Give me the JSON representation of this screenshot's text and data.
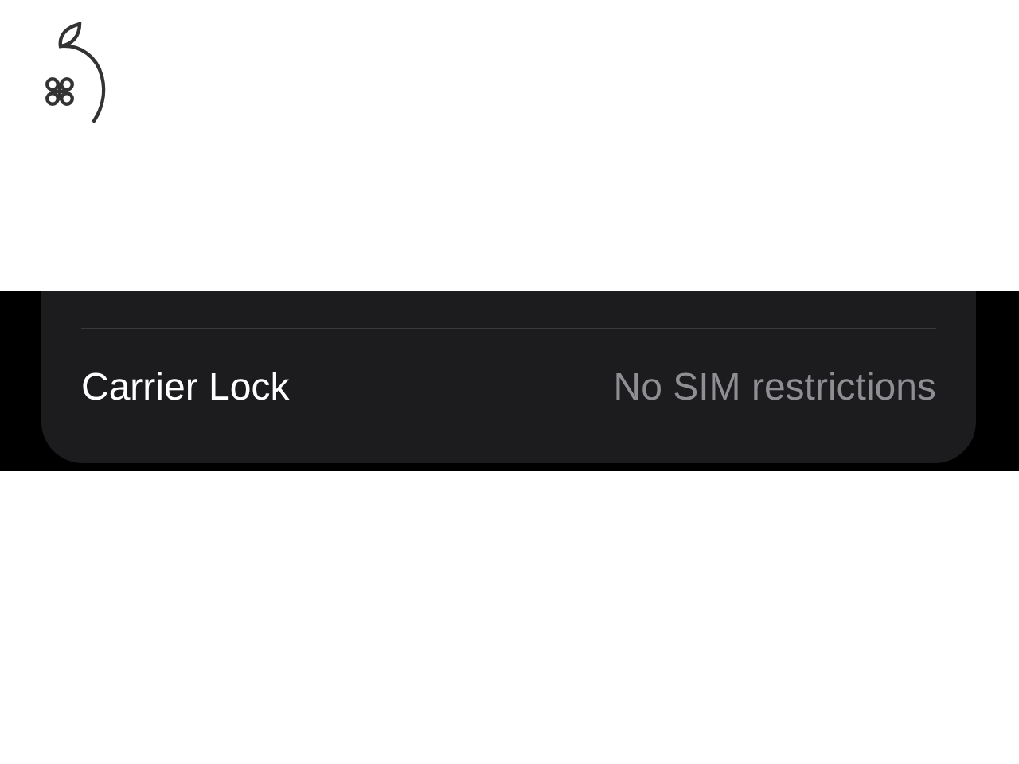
{
  "settings_row": {
    "label": "Carrier Lock",
    "value": "No SIM restrictions"
  }
}
